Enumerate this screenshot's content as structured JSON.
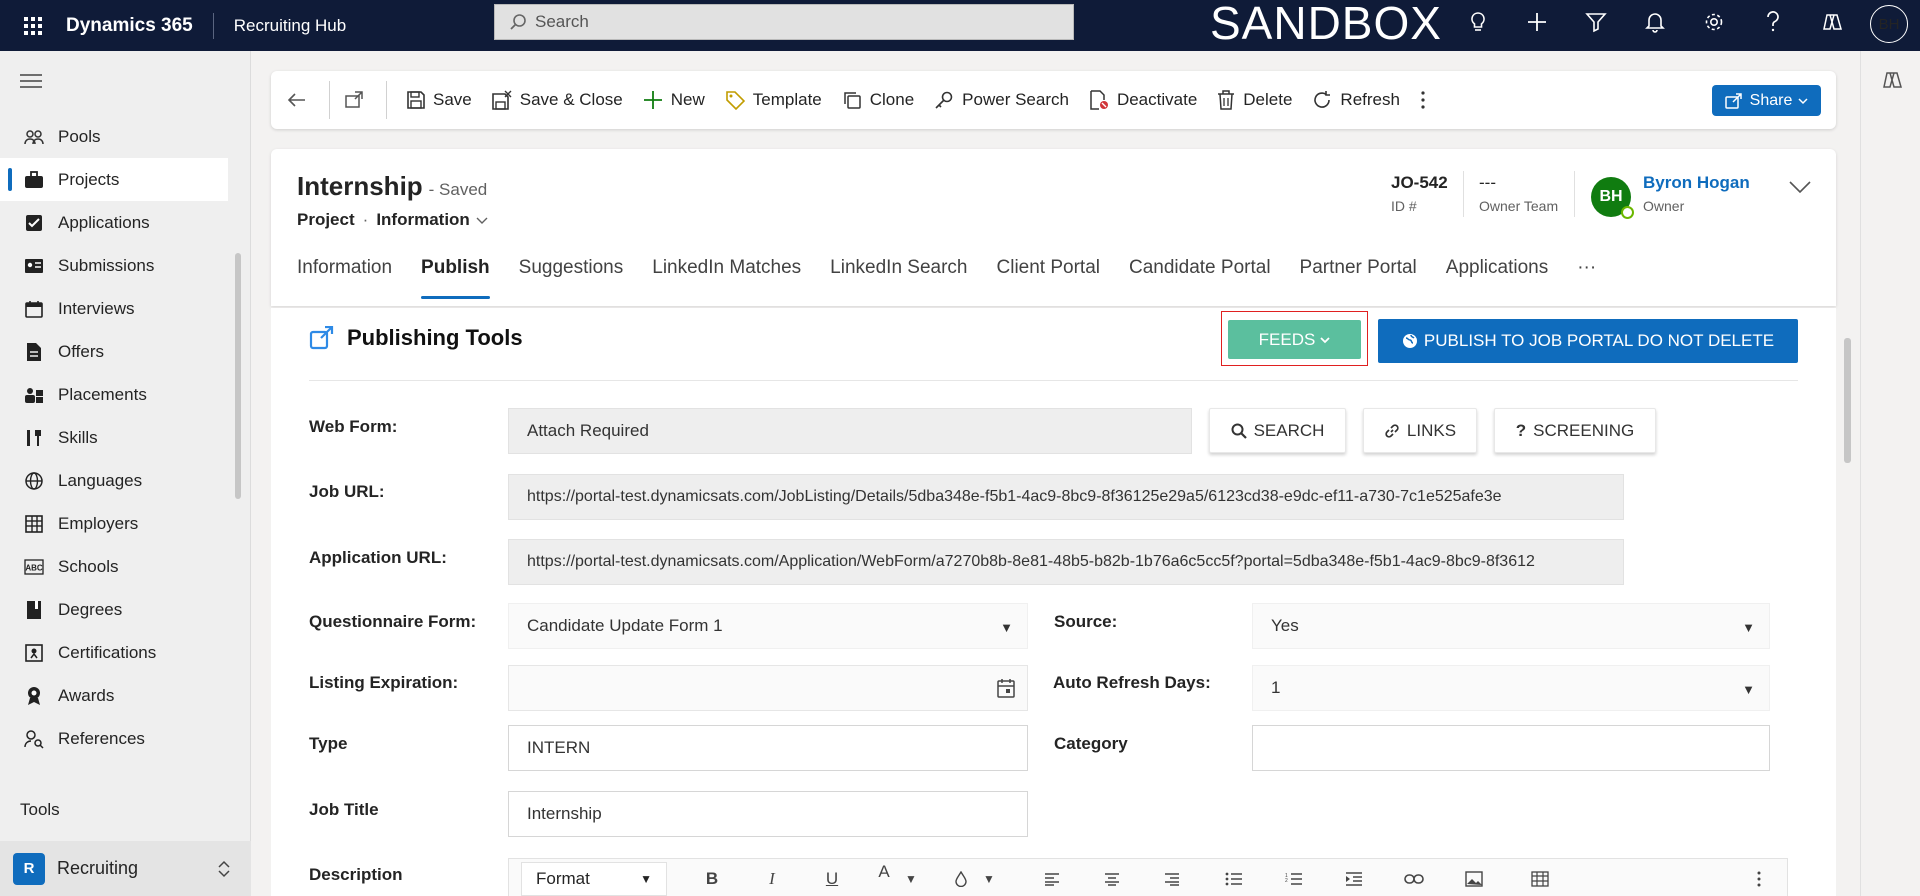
{
  "topbar": {
    "app_name": "Dynamics 365",
    "area_name": "Recruiting Hub",
    "search_placeholder": "Search",
    "environment_label": "SANDBOX",
    "user_initials": "BH",
    "icons": [
      "lightbulb-icon",
      "plus-icon",
      "filter-icon",
      "bell-icon",
      "gear-icon",
      "help-icon",
      "copilot-icon"
    ]
  },
  "sidebar": {
    "items": [
      {
        "label": "Pools",
        "icon": "people-icon"
      },
      {
        "label": "Projects",
        "icon": "briefcase-icon",
        "selected": true
      },
      {
        "label": "Applications",
        "icon": "checkbox-icon"
      },
      {
        "label": "Submissions",
        "icon": "id-card-icon"
      },
      {
        "label": "Interviews",
        "icon": "calendar-icon"
      },
      {
        "label": "Offers",
        "icon": "document-icon"
      },
      {
        "label": "Placements",
        "icon": "placement-icon"
      },
      {
        "label": "Skills",
        "icon": "tools-icon"
      },
      {
        "label": "Languages",
        "icon": "globe-icon"
      },
      {
        "label": "Employers",
        "icon": "building-icon"
      },
      {
        "label": "Schools",
        "icon": "abc-icon"
      },
      {
        "label": "Degrees",
        "icon": "book-icon"
      },
      {
        "label": "Certifications",
        "icon": "certificate-icon"
      },
      {
        "label": "Awards",
        "icon": "award-icon"
      },
      {
        "label": "References",
        "icon": "person-search-icon"
      }
    ],
    "tools_heading": "Tools",
    "area_switcher": {
      "badge": "R",
      "label": "Recruiting"
    }
  },
  "commandbar": {
    "save": "Save",
    "save_close": "Save & Close",
    "new": "New",
    "template": "Template",
    "clone": "Clone",
    "power_search": "Power Search",
    "deactivate": "Deactivate",
    "delete": "Delete",
    "refresh": "Refresh",
    "share": "Share"
  },
  "record": {
    "title": "Internship",
    "status": "- Saved",
    "entity": "Project",
    "separator": "·",
    "form": "Information",
    "id_value": "JO-542",
    "id_label": "ID #",
    "owner_team_value": "---",
    "owner_team_label": "Owner Team",
    "owner_initials": "BH",
    "owner_name": "Byron Hogan",
    "owner_label": "Owner"
  },
  "tabs": [
    "Information",
    "Publish",
    "Suggestions",
    "LinkedIn Matches",
    "LinkedIn Search",
    "Client Portal",
    "Candidate Portal",
    "Partner Portal",
    "Applications",
    "···"
  ],
  "active_tab": "Publish",
  "publishing": {
    "section_title": "Publishing Tools",
    "feeds_button": "FEEDS",
    "publish_button": "PUBLISH TO JOB PORTAL DO NOT DELETE",
    "search_button": "SEARCH",
    "links_button": "LINKS",
    "screening_button": "SCREENING",
    "fields": {
      "web_form": {
        "label": "Web Form:",
        "value": "Attach Required"
      },
      "job_url": {
        "label": "Job URL:",
        "value": "https://portal-test.dynamicsats.com/JobListing/Details/5dba348e-f5b1-4ac9-8bc9-8f36125e29a5/6123cd38-e9dc-ef11-a730-7c1e525afe3e"
      },
      "application_url": {
        "label": "Application URL:",
        "value": "https://portal-test.dynamicsats.com/Application/WebForm/a7270b8b-8e81-48b5-b82b-1b76a6c5cc5f?portal=5dba348e-f5b1-4ac9-8bc9-8f3612"
      },
      "questionnaire_form": {
        "label": "Questionnaire Form:",
        "value": "Candidate Update Form 1"
      },
      "source": {
        "label": "Source:",
        "value": "Yes"
      },
      "listing_expiration": {
        "label": "Listing Expiration:",
        "value": ""
      },
      "auto_refresh_days": {
        "label": "Auto Refresh Days:",
        "value": "1"
      },
      "type": {
        "label": "Type",
        "value": "INTERN"
      },
      "category": {
        "label": "Category",
        "value": ""
      },
      "job_title": {
        "label": "Job Title",
        "value": "Internship"
      },
      "description": {
        "label": "Description"
      }
    },
    "editor_toolbar": {
      "format": "Format",
      "bold": "B",
      "italic": "I",
      "underline": "U",
      "font_color": "A"
    }
  },
  "colors": {
    "topbar": "#0f1b38",
    "accent": "#0f6cbd",
    "feeds": "#5bbf9e",
    "highlight_border": "#e02020",
    "owner_avatar": "#107c10"
  }
}
